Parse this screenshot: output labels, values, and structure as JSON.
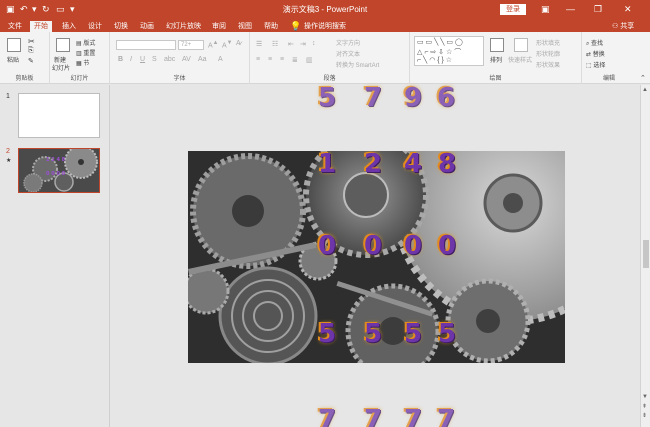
{
  "titlebar": {
    "title": "演示文稿3  -  PowerPoint",
    "login_label": "登录",
    "icons": [
      "save-icon",
      "undo-icon",
      "redo-icon",
      "present-icon"
    ],
    "window_icons": [
      "ribbon-display-icon",
      "minimize-icon",
      "restore-icon",
      "close-icon"
    ]
  },
  "tabs": [
    "文件",
    "开始",
    "插入",
    "设计",
    "切换",
    "动画",
    "幻灯片放映",
    "审阅",
    "视图",
    "帮助",
    "操作说明搜索"
  ],
  "active_tab": "开始",
  "share_label": "共享",
  "ribbon": {
    "clipboard": {
      "paste": "粘贴",
      "label": "剪贴板"
    },
    "slides": {
      "new_slide": "新建",
      "new_slide_line2": "幻灯片",
      "layout": "版式",
      "reset": "重置",
      "section": "节",
      "label": "幻灯片"
    },
    "font": {
      "label": "字体",
      "size": "72+"
    },
    "paragraph": {
      "text_direction": "文字方向",
      "align_text": "对齐文本",
      "smartart": "转换为 SmartArt",
      "label": "段落"
    },
    "drawing": {
      "arrange": "排列",
      "quick_styles": "快速样式",
      "shape_fill": "形状填充",
      "shape_outline": "形状轮廓",
      "shape_effects": "形状效果",
      "label": "绘图"
    },
    "editing": {
      "find": "查找",
      "replace": "替换",
      "select": "选择",
      "label": "编辑"
    }
  },
  "thumbnails": [
    {
      "number": "1"
    },
    {
      "number": "2",
      "star": "★"
    }
  ],
  "slide_digits": {
    "above_row": [
      "5",
      "7",
      "9",
      "6"
    ],
    "row1": [
      "1",
      "2",
      "4",
      "8"
    ],
    "row2": [
      "0",
      "0",
      "0",
      "0"
    ],
    "row3": [
      "5",
      "5",
      "5",
      "5"
    ],
    "below_row": [
      "7",
      "7",
      "7",
      "7"
    ]
  },
  "colors": {
    "accent": "#c0452a",
    "digit_fill": "#6d35a8",
    "digit_glow": "#e38a1c"
  }
}
